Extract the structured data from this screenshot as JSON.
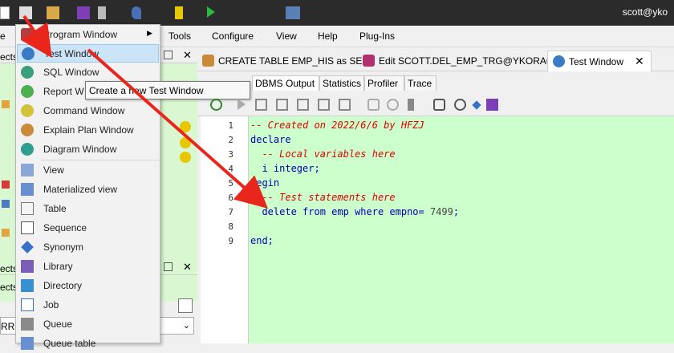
{
  "titlebar": {
    "user": "scott@yko"
  },
  "menu": {
    "items": [
      "Tools",
      "Configure",
      "View",
      "Help",
      "Plug-Ins"
    ]
  },
  "left_fragments": {
    "top_label": "ects",
    "p1": "ects",
    "p2": "ects",
    "p3": "RRE"
  },
  "dropdown": {
    "items": [
      {
        "label": "Program Window",
        "icon": "program-window-icon",
        "submenu": true
      },
      {
        "label": "Test Window",
        "icon": "test-window-icon",
        "highlighted": true
      },
      {
        "label": "SQL Window",
        "icon": "sql-window-icon"
      },
      {
        "label": "Report W",
        "icon": "report-window-icon"
      },
      {
        "label": "Command Window",
        "icon": "command-window-icon"
      },
      {
        "label": "Explain Plan Window",
        "icon": "explain-plan-icon"
      },
      {
        "label": "Diagram Window",
        "icon": "diagram-window-icon"
      },
      {
        "label": "View",
        "icon": "view-icon"
      },
      {
        "label": "Materialized view",
        "icon": "materialized-view-icon"
      },
      {
        "label": "Table",
        "icon": "table-icon"
      },
      {
        "label": "Sequence",
        "icon": "sequence-icon"
      },
      {
        "label": "Synonym",
        "icon": "synonym-icon"
      },
      {
        "label": "Library",
        "icon": "library-icon"
      },
      {
        "label": "Directory",
        "icon": "directory-icon"
      },
      {
        "label": "Job",
        "icon": "job-icon"
      },
      {
        "label": "Queue",
        "icon": "queue-icon"
      },
      {
        "label": "Queue table",
        "icon": "queue-table-icon"
      }
    ]
  },
  "tooltip": "Create a new Test Window",
  "doc_tabs": [
    {
      "label": "CREATE TABLE EMP_HIS as SE ..."
    },
    {
      "label": "Edit SCOTT.DEL_EMP_TRG@YKORACLE"
    },
    {
      "label": "Test Window",
      "active": true
    }
  ],
  "sub_tabs": [
    "DBMS Output",
    "Statistics",
    "Profiler",
    "Trace"
  ],
  "code": {
    "line_numbers": [
      "1",
      "2",
      "3",
      "4",
      "5",
      "6",
      "7",
      "8",
      "9"
    ],
    "l1": "-- Created on 2022/6/6 by HFZJ",
    "l2": "declare",
    "l3": "  -- Local variables here",
    "l4a": "  i ",
    "l4b": "integer",
    "l4c": ";",
    "l5": "begin",
    "l6": "  -- Test statements here",
    "l7a": "  delete ",
    "l7b": "from",
    "l7c": " emp ",
    "l7d": "where",
    "l7e": " empno= ",
    "l7f": "7499",
    "l7g": ";",
    "l9": "end;"
  },
  "colors": {
    "accent_red": "#e8261c",
    "editor_bg": "#ccffcc",
    "highlight": "#cce4f7"
  }
}
